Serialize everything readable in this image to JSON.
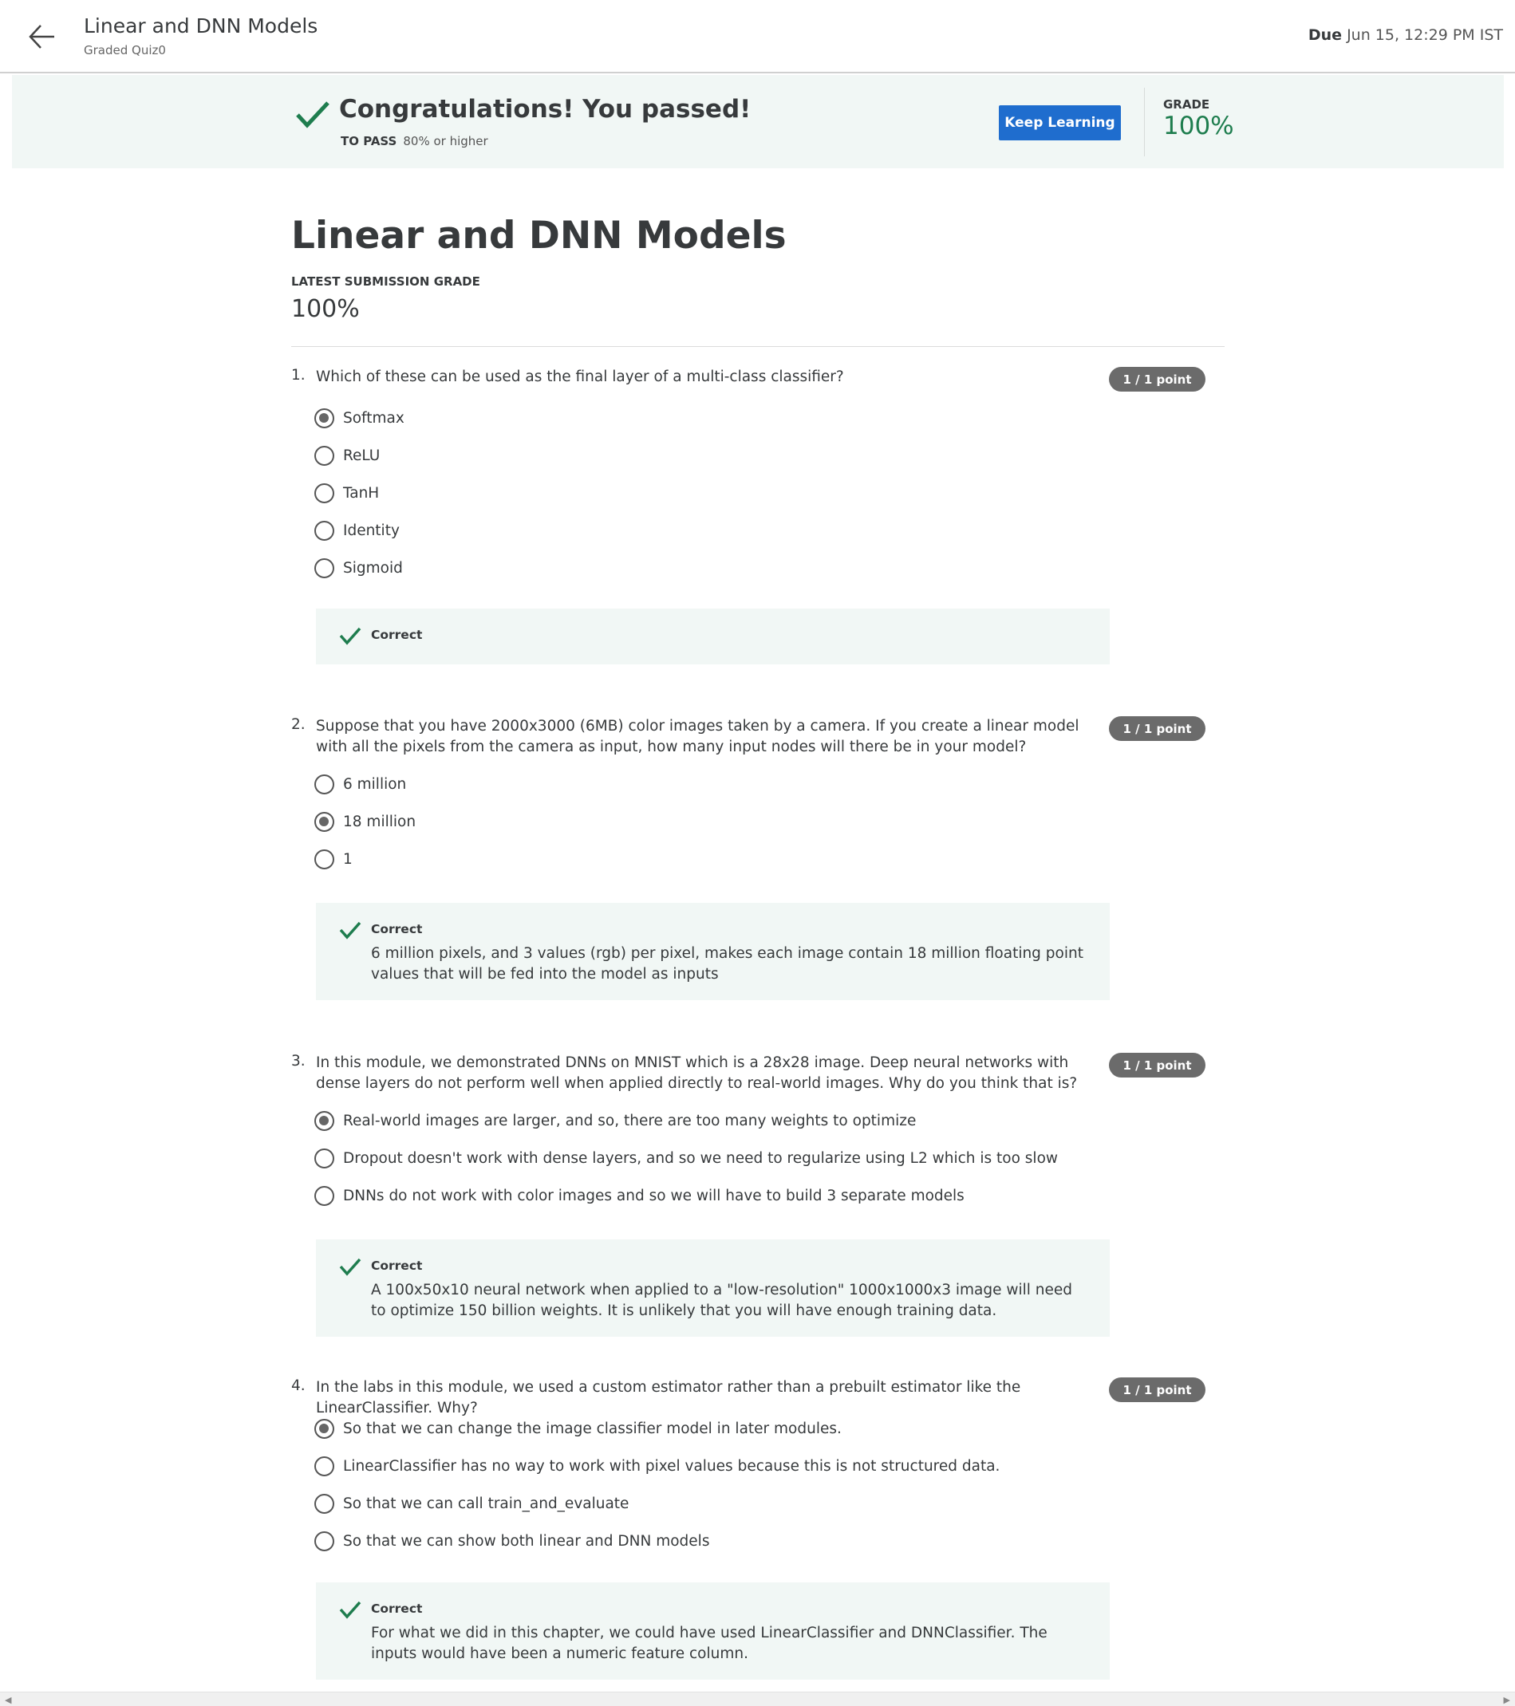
{
  "header": {
    "title": "Linear and DNN Models",
    "subtitle": "Graded Quiz0",
    "due_label": "Due",
    "due_value": "Jun 15, 12:29 PM IST"
  },
  "banner": {
    "title": "Congratulations! You passed!",
    "to_pass_label": "TO PASS",
    "to_pass_value": "80% or higher",
    "keep_learning": "Keep Learning",
    "grade_label": "GRADE",
    "grade_value": "100%"
  },
  "main": {
    "title": "Linear and DNN Models",
    "latest_label": "LATEST SUBMISSION GRADE",
    "latest_value": "100%"
  },
  "questions": [
    {
      "num": "1.",
      "text": "Which of these can be used as the final layer of a multi-class classifier?",
      "points": "1 / 1 point",
      "options": [
        "Softmax",
        "ReLU",
        "TanH",
        "Identity",
        "Sigmoid"
      ],
      "selected": 0,
      "feedback_title": "Correct",
      "feedback_text": ""
    },
    {
      "num": "2.",
      "text": "Suppose that you have 2000x3000 (6MB) color images taken by a camera. If you create a linear model with all the pixels from the camera as input, how many input nodes will there be in your model?",
      "points": "1 / 1 point",
      "options": [
        "6 million",
        "18 million",
        "1"
      ],
      "selected": 1,
      "feedback_title": "Correct",
      "feedback_text": "6 million pixels, and 3 values (rgb) per pixel, makes each image contain 18 million floating point values that will be fed into the model as inputs"
    },
    {
      "num": "3.",
      "text": "In this module, we demonstrated DNNs on MNIST which is a 28x28 image. Deep neural networks with dense layers do not perform well when applied directly to real-world images. Why do you think that is?",
      "points": "1 / 1 point",
      "options": [
        "Real-world images are larger, and so, there are too many weights to optimize",
        "Dropout doesn't work with dense layers, and so we need to regularize using L2 which is too slow",
        "DNNs do not work with color images and so we will have to build 3 separate models"
      ],
      "selected": 0,
      "feedback_title": "Correct",
      "feedback_text": "A 100x50x10 neural network when applied to a \"low-resolution\" 1000x1000x3 image will need to optimize 150 billion weights. It is unlikely that you will have enough training data."
    },
    {
      "num": "4.",
      "text": "In the labs in this module, we used a custom estimator rather than a prebuilt estimator like the LinearClassifier. Why?",
      "points": "1 / 1 point",
      "options": [
        "So that we can change the image classifier model in later modules.",
        "LinearClassifier has no way to work with pixel values because this is not structured data.",
        "So that we can call train_and_evaluate",
        "So that we can show both linear and DNN models"
      ],
      "selected": 0,
      "feedback_title": "Correct",
      "feedback_text": "For what we did in this chapter, we could have used LinearClassifier and DNNClassifier. The inputs would have been a numeric feature column."
    }
  ],
  "colors": {
    "accent": "#1f6dce",
    "success": "#1e7d4e",
    "banner_bg": "#f1f7f5",
    "badge_bg": "#6b6b6b"
  },
  "icons": {
    "back": "arrow-left-icon",
    "check": "checkmark-icon"
  }
}
